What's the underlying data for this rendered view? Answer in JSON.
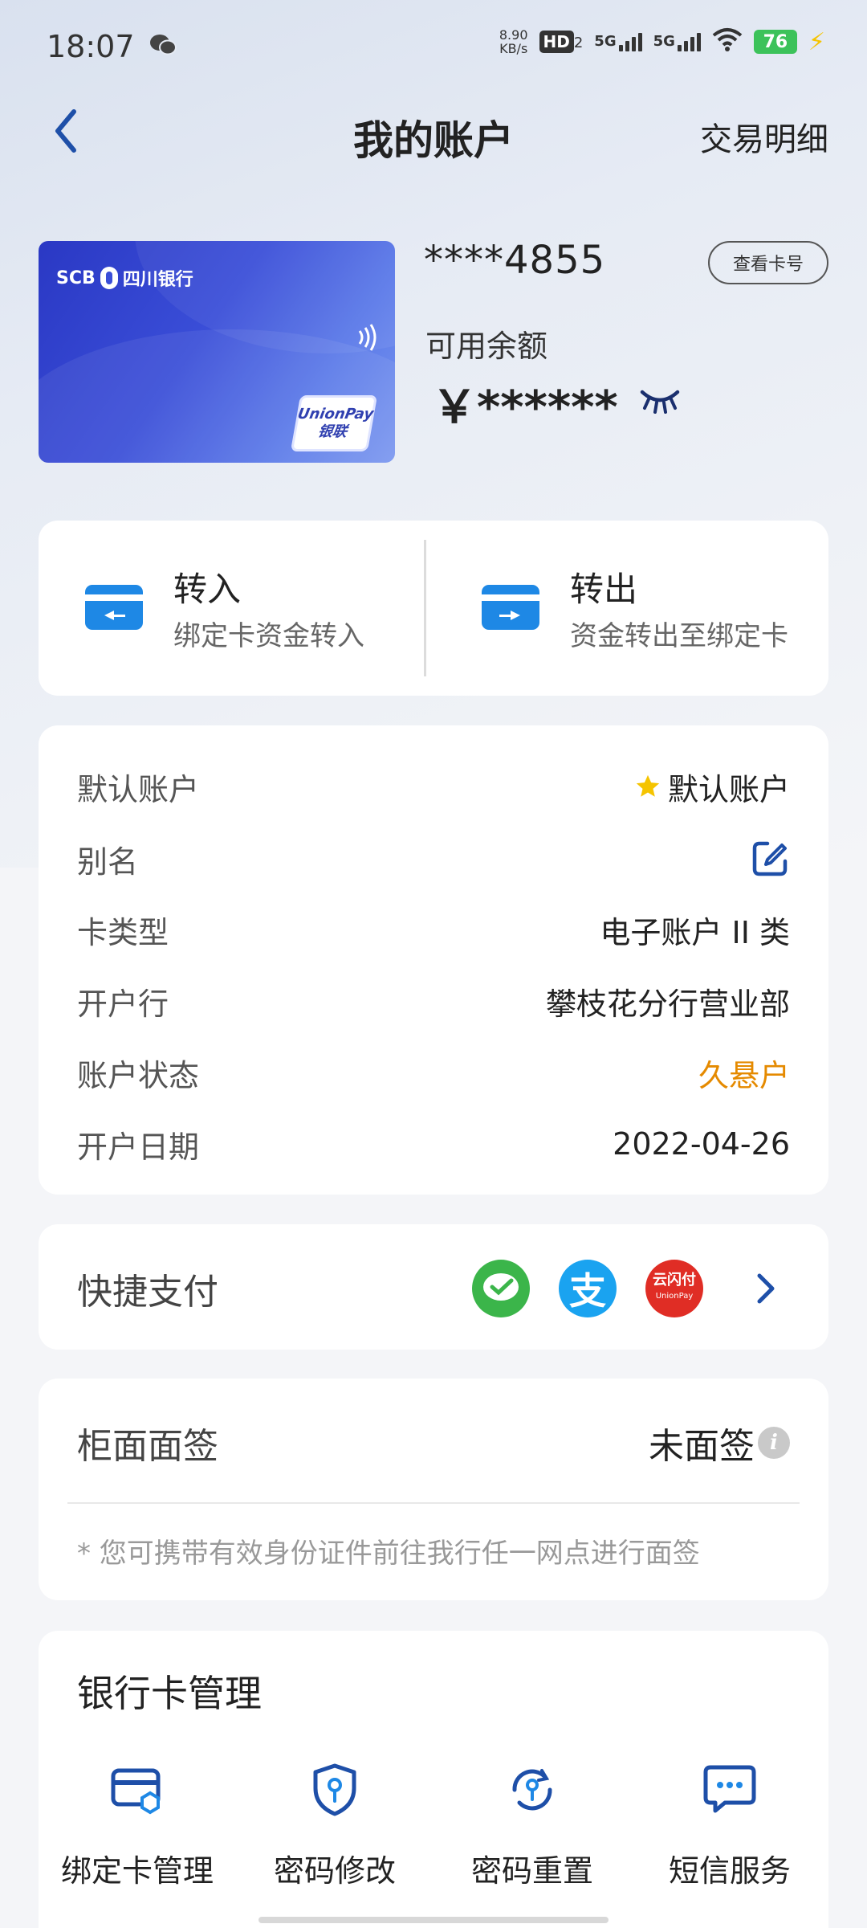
{
  "status_bar": {
    "time": "18:07",
    "net_speed_value": "8.90",
    "net_speed_unit": "KB/s",
    "hd_label": "HD",
    "hd_sub": "2",
    "signal1_label": "5G",
    "signal2_label": "5G",
    "battery": "76"
  },
  "nav": {
    "title": "我的账户",
    "right_link": "交易明细"
  },
  "card": {
    "bank_short": "SCB",
    "bank_name": "四川银行",
    "unionpay_en": "UnionPay",
    "unionpay_cn": "银联",
    "number": "****4855",
    "view_button": "查看卡号",
    "balance_label": "可用余额",
    "balance_value": "￥******"
  },
  "transfer": {
    "in_title": "转入",
    "in_sub": "绑定卡资金转入",
    "out_title": "转出",
    "out_sub": "资金转出至绑定卡"
  },
  "info": {
    "default_key": "默认账户",
    "default_value": "默认账户",
    "alias_key": "别名",
    "card_type_key": "卡类型",
    "card_type_value": "电子账户 II 类",
    "branch_key": "开户行",
    "branch_value": "攀枝花分行营业部",
    "status_key": "账户状态",
    "status_value": "久悬户",
    "date_key": "开户日期",
    "date_value": "2022-04-26"
  },
  "quickpay": {
    "label": "快捷支付",
    "icons": [
      "wechat-pay-icon",
      "alipay-icon",
      "cloud-quickpass-icon"
    ],
    "alipay_glyph": "支",
    "cloud_text": "云闪付",
    "cloud_sub": "UnionPay"
  },
  "facesign": {
    "label": "柜面面签",
    "status": "未面签",
    "note": "* 您可携带有效身份证件前往我行任一网点进行面签"
  },
  "manage": {
    "title": "银行卡管理",
    "items": [
      {
        "label": "绑定卡管理",
        "icon": "bound-card-icon"
      },
      {
        "label": "密码修改",
        "icon": "password-shield-icon"
      },
      {
        "label": "密码重置",
        "icon": "password-reset-icon"
      },
      {
        "label": "短信服务",
        "icon": "sms-icon"
      }
    ]
  },
  "colors": {
    "accent": "#1e4fa8",
    "warning": "#e58a00",
    "card": "#3a4ed8",
    "transfer_icon": "#1e88e5"
  }
}
